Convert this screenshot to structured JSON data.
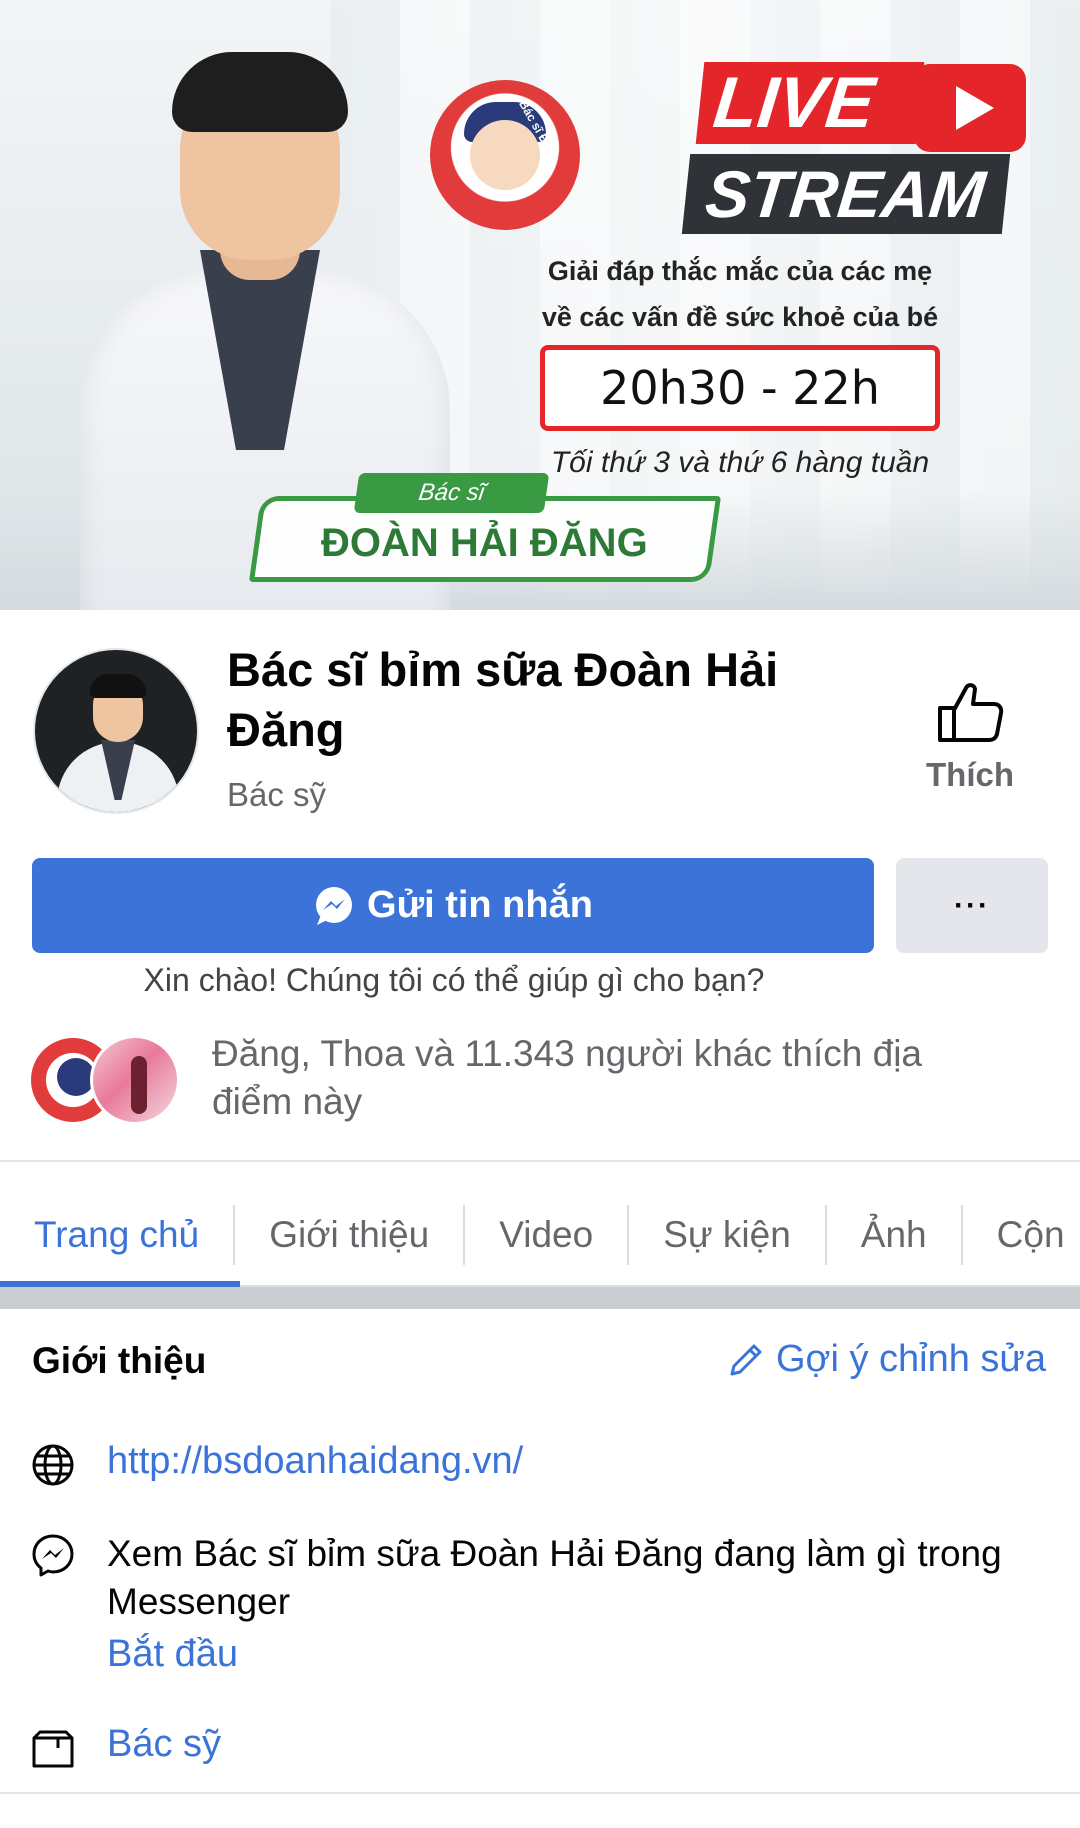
{
  "cover": {
    "live_line1": "LIVE",
    "live_line2": "STREAM",
    "subtitle_line1": "Giải đáp thắc mắc của các mẹ",
    "subtitle_line2": "về các vấn đề sức khoẻ của bé",
    "time": "20h30 - 22h",
    "days": "Tối thứ 3 và thứ 6 hàng tuần",
    "badge_top": "Bác sĩ",
    "badge_name": "ĐOÀN HẢI ĐĂNG",
    "mascot_tag": "Bác sĩ Đăng"
  },
  "profile": {
    "name": "Bác sĩ bỉm sữa Đoàn Hải Đăng",
    "category": "Bác sỹ",
    "like_label": "Thích",
    "like_icon": "thumbs-up-icon"
  },
  "actions": {
    "message_label": "Gửi tin nhắn",
    "message_icon": "messenger-icon",
    "more_label": "···",
    "greeting": "Xin chào! Chúng tôi có thể giúp gì cho bạn?"
  },
  "social": {
    "likes_text": "Đăng, Thoa và 11.343 người khác thích địa điểm này"
  },
  "tabs": [
    {
      "label": "Trang chủ",
      "active": true
    },
    {
      "label": "Giới thiệu",
      "active": false
    },
    {
      "label": "Video",
      "active": false
    },
    {
      "label": "Sự kiện",
      "active": false
    },
    {
      "label": "Ảnh",
      "active": false
    },
    {
      "label": "Cộn",
      "active": false
    }
  ],
  "intro": {
    "title": "Giới thiệu",
    "suggest_edit": "Gợi ý chỉnh sửa",
    "website": "http://bsdoanhaidang.vn/",
    "messenger_text": "Xem Bác sĩ bỉm sữa Đoàn Hải Đăng đang làm gì trong Messenger",
    "start_link": "Bắt đầu",
    "category_link": "Bác sỹ"
  },
  "colors": {
    "accent": "#3b73d8",
    "secondary_text": "#65676b",
    "live_red": "#e4262a",
    "badge_green": "#3a9a44"
  }
}
